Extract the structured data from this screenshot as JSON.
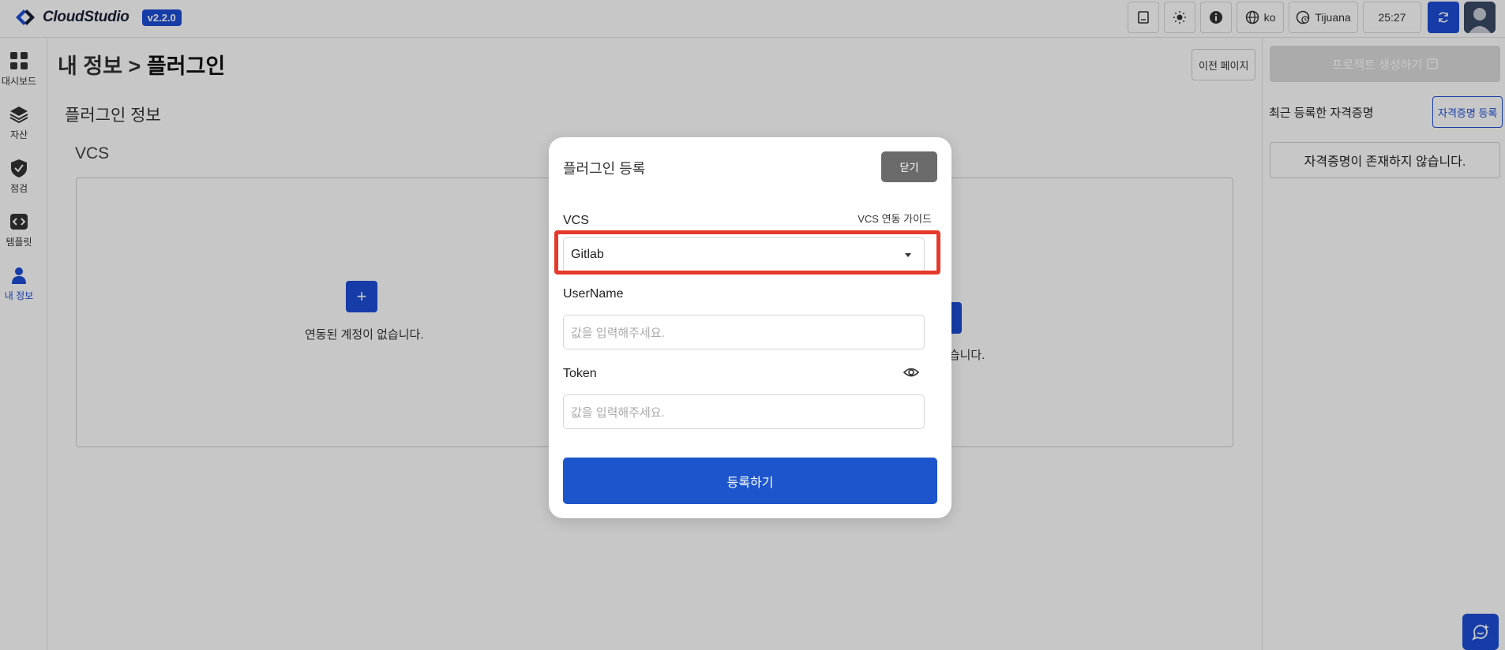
{
  "app": {
    "logo_text": "CloudStudio",
    "version": "v2.2.0"
  },
  "topbar": {
    "language": "ko",
    "timezone": "Tijuana",
    "time": "25:27"
  },
  "sidebar": {
    "items": [
      {
        "label": "대시보드",
        "icon": "dashboard-icon"
      },
      {
        "label": "자산",
        "icon": "layers-icon"
      },
      {
        "label": "점검",
        "icon": "shield-check-icon"
      },
      {
        "label": "템플릿",
        "icon": "code-icon"
      },
      {
        "label": "내 정보",
        "icon": "user-icon",
        "active": true
      }
    ]
  },
  "breadcrumb": {
    "parent": "내 정보",
    "separator": ">",
    "current": "플러그인"
  },
  "main": {
    "prev_page_label": "이전 페이지",
    "section_title": "플러그인 정보",
    "vcs_title": "VCS",
    "no_account_text": "연동된 계정이 없습니다.",
    "no_account_text_partial": "이 없습니다."
  },
  "right_panel": {
    "create_project_label": "프로젝트 생성하기",
    "recent_credentials_title": "최근 등록한 자격증명",
    "register_credential_label": "자격증명 등록",
    "empty_credentials_text": "자격증명이 존재하지 않습니다."
  },
  "modal": {
    "title": "플러그인 등록",
    "close_label": "닫기",
    "vcs_label": "VCS",
    "vcs_guide_link": "VCS 연동 가이드",
    "vcs_selected": "Gitlab",
    "username_label": "UserName",
    "username_placeholder": "값을 입력해주세요.",
    "token_label": "Token",
    "token_placeholder": "값을 입력해주세요.",
    "submit_label": "등록하기"
  },
  "colors": {
    "primary": "#1d4ed8",
    "highlight": "#e53a2b",
    "close_button": "#6b6b6b"
  }
}
